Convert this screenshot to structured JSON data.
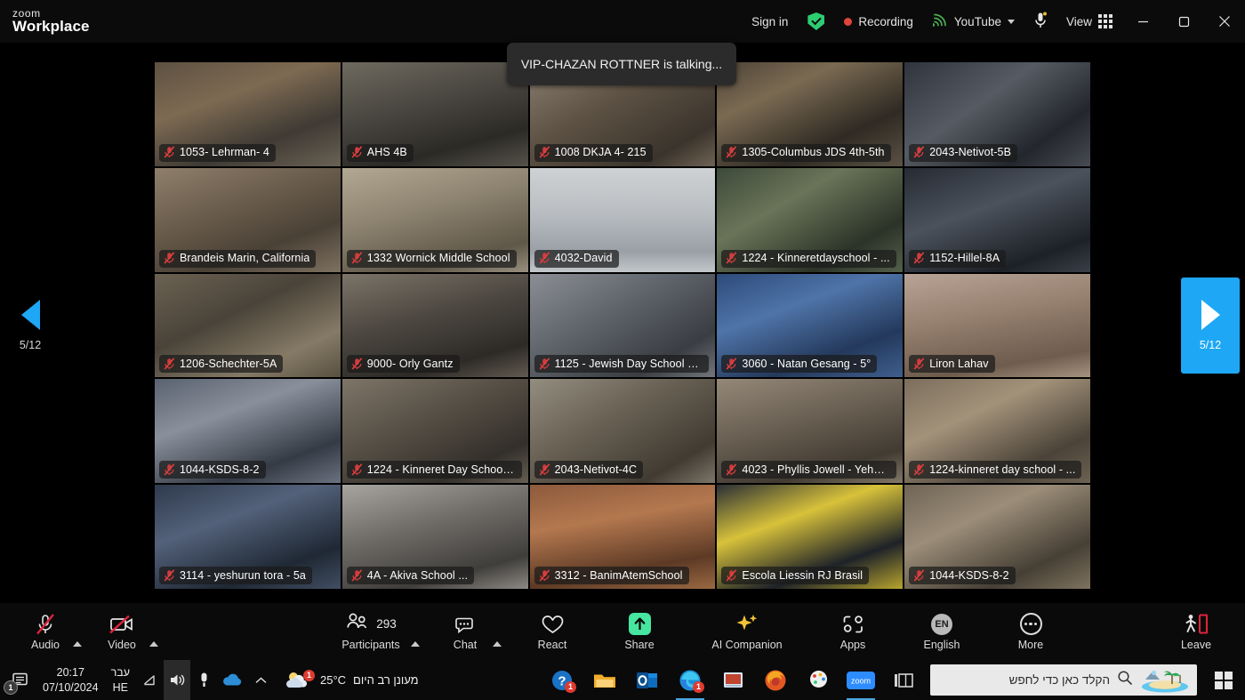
{
  "app": {
    "brand_line1": "zoom",
    "brand_line2": "Workplace"
  },
  "topbar": {
    "sign_in": "Sign in",
    "encryption_icon": "shield-check-icon",
    "recording_label": "Recording",
    "youtube_label": "YouTube",
    "mic_icon": "microphone-icon",
    "view_label": "View",
    "view_icon": "grid-view-icon",
    "minimize_icon": "minimize-icon",
    "restore_icon": "restore-icon",
    "close_icon": "close-icon"
  },
  "speaking_tooltip": {
    "text": "VIP-CHAZAN ROTTNER is talking..."
  },
  "pager": {
    "prev_label": "5/12",
    "next_label": "5/12",
    "prev_icon": "triangle-left-icon",
    "next_icon": "triangle-right-icon",
    "accent_color": "#1ea7f5"
  },
  "gallery": {
    "mic_muted_icon": "mic-muted-icon",
    "participants": [
      {
        "name": "1053- Lehrman- 4",
        "muted": true,
        "bg": "c1"
      },
      {
        "name": "AHS 4B",
        "muted": true,
        "bg": "c2"
      },
      {
        "name": "1008 DKJA 4- 215",
        "muted": true,
        "bg": "c3"
      },
      {
        "name": "1305-Columbus JDS 4th-5th",
        "muted": true,
        "bg": "c4"
      },
      {
        "name": "2043-Netivot-5B",
        "muted": true,
        "bg": "c5"
      },
      {
        "name": "Brandeis Marin, California",
        "muted": true,
        "bg": "c6"
      },
      {
        "name": "1332 Wornick Middle School",
        "muted": true,
        "bg": "c7"
      },
      {
        "name": "4032-David",
        "muted": true,
        "bg": "c8"
      },
      {
        "name": "1224 - Kinneretdayschool - ...",
        "muted": true,
        "bg": "c9"
      },
      {
        "name": "1152-Hillel-8A",
        "muted": true,
        "bg": "c10"
      },
      {
        "name": "1206-Schechter-5A",
        "muted": true,
        "bg": "c11"
      },
      {
        "name": "9000-  Orly Gantz",
        "muted": true,
        "bg": "c12"
      },
      {
        "name": "1125 - Jewish Day School of ...",
        "muted": true,
        "bg": "c13"
      },
      {
        "name": "3060 - Natan Gesang - 5°",
        "muted": true,
        "bg": "c14"
      },
      {
        "name": "Liron Lahav",
        "muted": true,
        "bg": "c15"
      },
      {
        "name": "1044-KSDS-8-2",
        "muted": true,
        "bg": "c16"
      },
      {
        "name": "1224 - Kinneret Day School ...",
        "muted": true,
        "bg": "c17"
      },
      {
        "name": "2043-Netivot-4C",
        "muted": true,
        "bg": "c18"
      },
      {
        "name": "4023 - Phyllis Jowell - Yehos...",
        "muted": true,
        "bg": "c19"
      },
      {
        "name": "1224-kinneret day school - ...",
        "muted": true,
        "bg": "c20"
      },
      {
        "name": "3114 - yeshurun tora - 5a",
        "muted": true,
        "bg": "c21"
      },
      {
        "name": "4A - Akiva School ...",
        "muted": true,
        "bg": "c22"
      },
      {
        "name": "3312 - BanimAtemSchool",
        "muted": true,
        "bg": "c23"
      },
      {
        "name": "Escola Liessin RJ Brasil",
        "muted": true,
        "bg": "c24"
      },
      {
        "name": "1044-KSDS-8-2",
        "muted": true,
        "bg": "c25"
      }
    ]
  },
  "toolbar": {
    "audio": {
      "label": "Audio",
      "icon": "microphone-muted-icon",
      "has_caret": true
    },
    "video": {
      "label": "Video",
      "icon": "camera-muted-icon",
      "has_caret": true
    },
    "participants": {
      "label": "Participants",
      "icon": "participants-icon",
      "count": "293",
      "has_caret": true
    },
    "chat": {
      "label": "Chat",
      "icon": "chat-bubble-icon",
      "has_caret": true
    },
    "react": {
      "label": "React",
      "icon": "heart-icon",
      "has_caret": false
    },
    "share": {
      "label": "Share",
      "icon": "share-screen-icon",
      "has_caret": false,
      "color": "#46e6a0"
    },
    "ai_companion": {
      "label": "AI Companion",
      "icon": "sparkle-icon",
      "has_caret": false,
      "color": "#f2c337"
    },
    "apps": {
      "label": "Apps",
      "icon": "apps-icon",
      "has_caret": false
    },
    "english": {
      "label": "English",
      "icon": "language-icon",
      "badge": "EN",
      "has_caret": false
    },
    "more": {
      "label": "More",
      "icon": "ellipsis-icon",
      "has_caret": false
    },
    "leave": {
      "label": "Leave",
      "icon": "leave-door-icon",
      "color": "#e0223c"
    }
  },
  "taskbar": {
    "notifications_icon": "notification-icon",
    "notifications_badge": "1",
    "clock_time": "20:17",
    "clock_date": "07/10/2024",
    "lang_line1": "עבר",
    "lang_line2": "HE",
    "network_icon": "wifi-icon",
    "volume_icon": "speaker-icon",
    "mic_tray_icon": "microphone-icon",
    "onedrive_icon": "cloud-icon",
    "overflow_icon": "chevron-up-icon",
    "weather_temp": "25°C",
    "weather_text": "מעונן רב היום",
    "weather_icon": "partly-cloudy-icon",
    "weather_badge": "1",
    "apps": [
      {
        "name": "help-icon",
        "badge": "1"
      },
      {
        "name": "file-explorer-icon",
        "badge": ""
      },
      {
        "name": "outlook-icon",
        "badge": ""
      },
      {
        "name": "edge-icon",
        "badge": "1"
      },
      {
        "name": "powerpoint-icon",
        "badge": ""
      },
      {
        "name": "firefox-icon",
        "badge": ""
      },
      {
        "name": "paint-icon",
        "badge": ""
      },
      {
        "name": "zoom-app-icon",
        "badge": ""
      },
      {
        "name": "task-view-icon",
        "badge": ""
      }
    ],
    "search_placeholder": "הקלד כאן כדי לחפש",
    "search_icon": "search-icon",
    "search_thumb_icon": "island-picture-icon",
    "start_icon": "windows-start-icon"
  }
}
